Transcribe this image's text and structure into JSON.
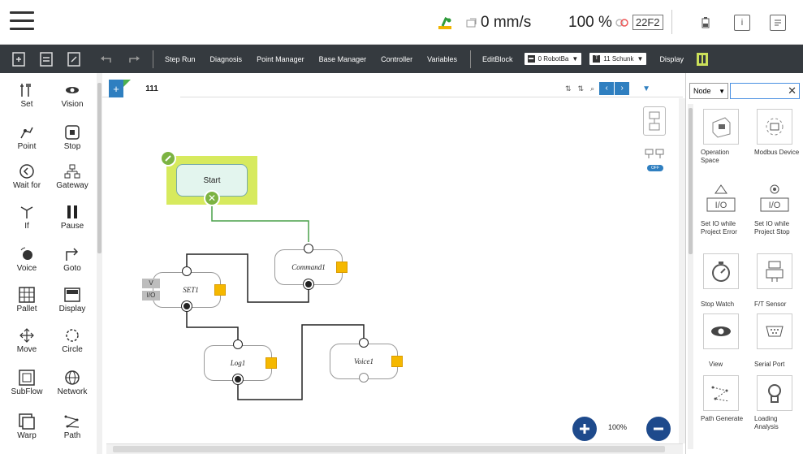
{
  "status": {
    "speed": "0 mm/s",
    "percent": "100 %",
    "project_code": "22F2"
  },
  "toolbar": {
    "step_run": "Step Run",
    "diagnosis": "Diagnosis",
    "point_manager": "Point Manager",
    "base_manager": "Base Manager",
    "controller": "Controller",
    "variables": "Variables",
    "edit_block": "EditBlock",
    "robot_base": "0 RobotBa",
    "tool": "11 Schunk",
    "display": "Display"
  },
  "palette": [
    {
      "label": "Set",
      "icon": "set-icon"
    },
    {
      "label": "Vision",
      "icon": "vision-icon"
    },
    {
      "label": "Point",
      "icon": "point-icon"
    },
    {
      "label": "Stop",
      "icon": "stop-icon"
    },
    {
      "label": "Wait for",
      "icon": "wait-for-icon"
    },
    {
      "label": "Gateway",
      "icon": "gateway-icon"
    },
    {
      "label": "If",
      "icon": "if-icon"
    },
    {
      "label": "Pause",
      "icon": "pause-icon"
    },
    {
      "label": "Voice",
      "icon": "voice-icon"
    },
    {
      "label": "Goto",
      "icon": "goto-icon"
    },
    {
      "label": "Pallet",
      "icon": "pallet-icon"
    },
    {
      "label": "Display",
      "icon": "display-icon"
    },
    {
      "label": "Move",
      "icon": "move-icon"
    },
    {
      "label": "Circle",
      "icon": "circle-icon"
    },
    {
      "label": "SubFlow",
      "icon": "subflow-icon"
    },
    {
      "label": "Network",
      "icon": "network-icon"
    },
    {
      "label": "Warp",
      "icon": "warp-icon"
    },
    {
      "label": "Path",
      "icon": "path-icon"
    }
  ],
  "tab": {
    "name": "111",
    "plus": "+"
  },
  "flow": {
    "start": "Start",
    "command1": "Command1",
    "set1": "SET1",
    "set1_tag_v": "V",
    "set1_tag_io": "I/O",
    "log1": "Log1",
    "voice1": "Voice1",
    "toggle": "OFF"
  },
  "zoom": "100%",
  "right_panel": {
    "filter": "Node",
    "search_placeholder": "",
    "items": [
      {
        "label": "Operation Space",
        "icon": "operation-space-icon"
      },
      {
        "label": "Modbus Device",
        "icon": "modbus-device-icon"
      },
      {
        "label": "Set IO while Project Error",
        "icon": "io-error-icon"
      },
      {
        "label": "Set IO while Project Stop",
        "icon": "io-stop-icon"
      },
      {
        "label": "Stop Watch",
        "icon": "stop-watch-icon"
      },
      {
        "label": "F/T Sensor",
        "icon": "ft-sensor-icon"
      },
      {
        "label": "View",
        "icon": "view-icon"
      },
      {
        "label": "Serial Port",
        "icon": "serial-port-icon"
      },
      {
        "label": "Path Generate",
        "icon": "path-generate-icon"
      },
      {
        "label": "Loading Analysis",
        "icon": "loading-analysis-icon"
      }
    ]
  },
  "colors": {
    "toolbar_bg": "#353a3f",
    "accent_blue": "#2f7fc0",
    "start_highlight": "#d7ea5e",
    "start_node": "#e3f5ee",
    "node_badge": "#f5b800",
    "connector_green": "#4aa14a"
  }
}
